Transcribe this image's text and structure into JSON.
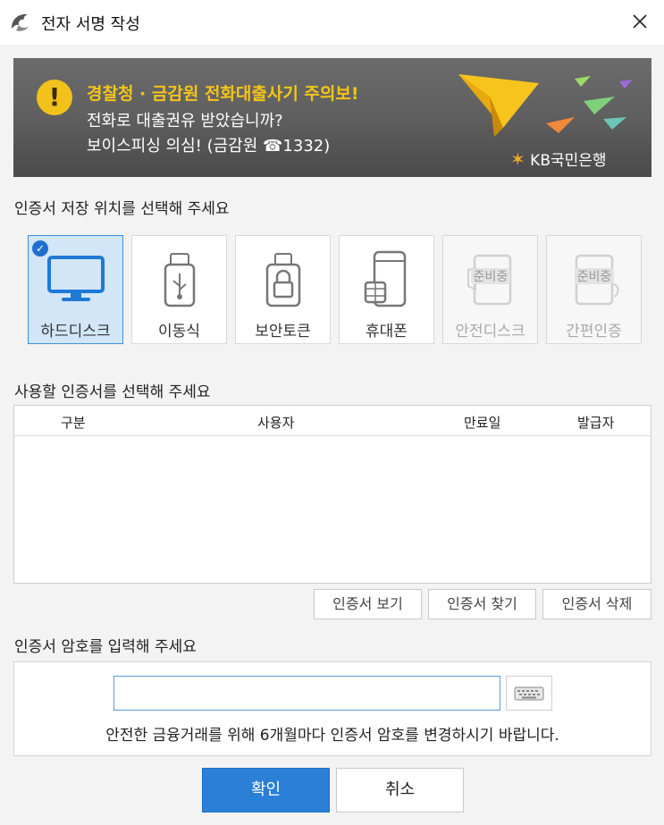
{
  "window": {
    "title": "전자 서명 작성"
  },
  "banner": {
    "line1": "경찰청 · 금감원 전화대출사기 주의보!",
    "line2": "전화로 대출권유 받았습니까?",
    "line3": "보이스피싱 의심! (금감원 ☎1332)",
    "logo_text": "KB국민은행",
    "brand_color": "#f2b01e"
  },
  "storage": {
    "section_label": "인증서 저장 위치를 선택해 주세요",
    "selected": "하드디스크",
    "options": [
      {
        "label": "하드디스크",
        "icon": "monitor-icon",
        "state": "selected"
      },
      {
        "label": "이동식",
        "icon": "usb-drive-icon",
        "state": "enabled"
      },
      {
        "label": "보안토큰",
        "icon": "security-token-icon",
        "state": "enabled"
      },
      {
        "label": "휴대폰",
        "icon": "smartphone-icon",
        "state": "enabled"
      },
      {
        "label": "안전디스크",
        "icon": "safe-disk-icon",
        "state": "disabled",
        "badge": "준비중"
      },
      {
        "label": "간편인증",
        "icon": "simple-auth-icon",
        "state": "disabled",
        "badge": "준비중"
      }
    ]
  },
  "certificates": {
    "section_label": "사용할 인증서를 선택해 주세요",
    "columns": [
      "구분",
      "사용자",
      "만료일",
      "발급자"
    ],
    "rows": []
  },
  "cert_actions": {
    "view": "인증서 보기",
    "find": "인증서 찾기",
    "delete": "인증서 삭제"
  },
  "password": {
    "section_label": "인증서 암호를 입력해 주세요",
    "value": "",
    "notice": "안전한 금융거래를 위해 6개월마다 인증서 암호를 변경하시기 바랍니다."
  },
  "buttons": {
    "ok": "확인",
    "cancel": "취소"
  },
  "colors": {
    "accent": "#2b7fd6",
    "selected_bg": "#d2e6f8",
    "warning": "#f5c518"
  }
}
